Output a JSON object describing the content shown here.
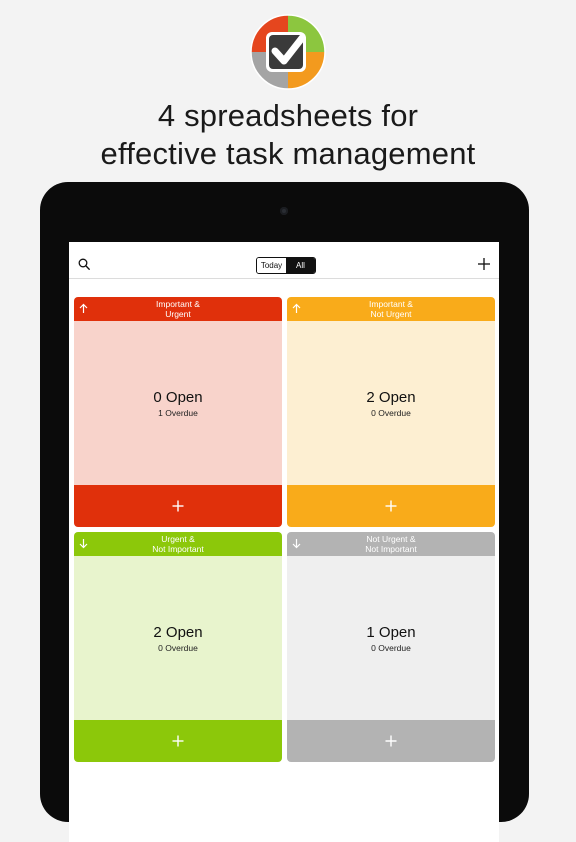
{
  "header": {
    "line1": "4 spreadsheets for",
    "line2": "effective task management"
  },
  "toolbar": {
    "segment_today": "Today",
    "segment_all": "All",
    "selected": "All"
  },
  "quadrants": [
    {
      "title_line1": "Important &",
      "title_line2": "Urgent",
      "open": "0 Open",
      "overdue": "1 Overdue",
      "arrow": "arrow-up-icon",
      "header_color": "#e0300b",
      "body_color": "#f8d3cb",
      "footer_color": "#e0300b"
    },
    {
      "title_line1": "Important &",
      "title_line2": "Not Urgent",
      "open": "2 Open",
      "overdue": "0 Overdue",
      "arrow": "arrow-up-icon",
      "header_color": "#f9ab1a",
      "body_color": "#fdefd2",
      "footer_color": "#f9ab1a"
    },
    {
      "title_line1": "Urgent &",
      "title_line2": "Not Important",
      "open": "2 Open",
      "overdue": "0 Overdue",
      "arrow": "arrow-down-icon",
      "header_color": "#8cc80a",
      "body_color": "#e8f4cd",
      "footer_color": "#8cc80a"
    },
    {
      "title_line1": "Not Urgent &",
      "title_line2": "Not Important",
      "open": "1 Open",
      "overdue": "0 Overdue",
      "arrow": "arrow-down-icon",
      "header_color": "#b3b3b3",
      "body_color": "#efefef",
      "footer_color": "#b3b3b3"
    }
  ],
  "colors": {
    "logo_red": "#e5461e",
    "logo_green": "#8cc63f",
    "logo_orange": "#f39a1e",
    "logo_gray": "#a4a4a4"
  }
}
